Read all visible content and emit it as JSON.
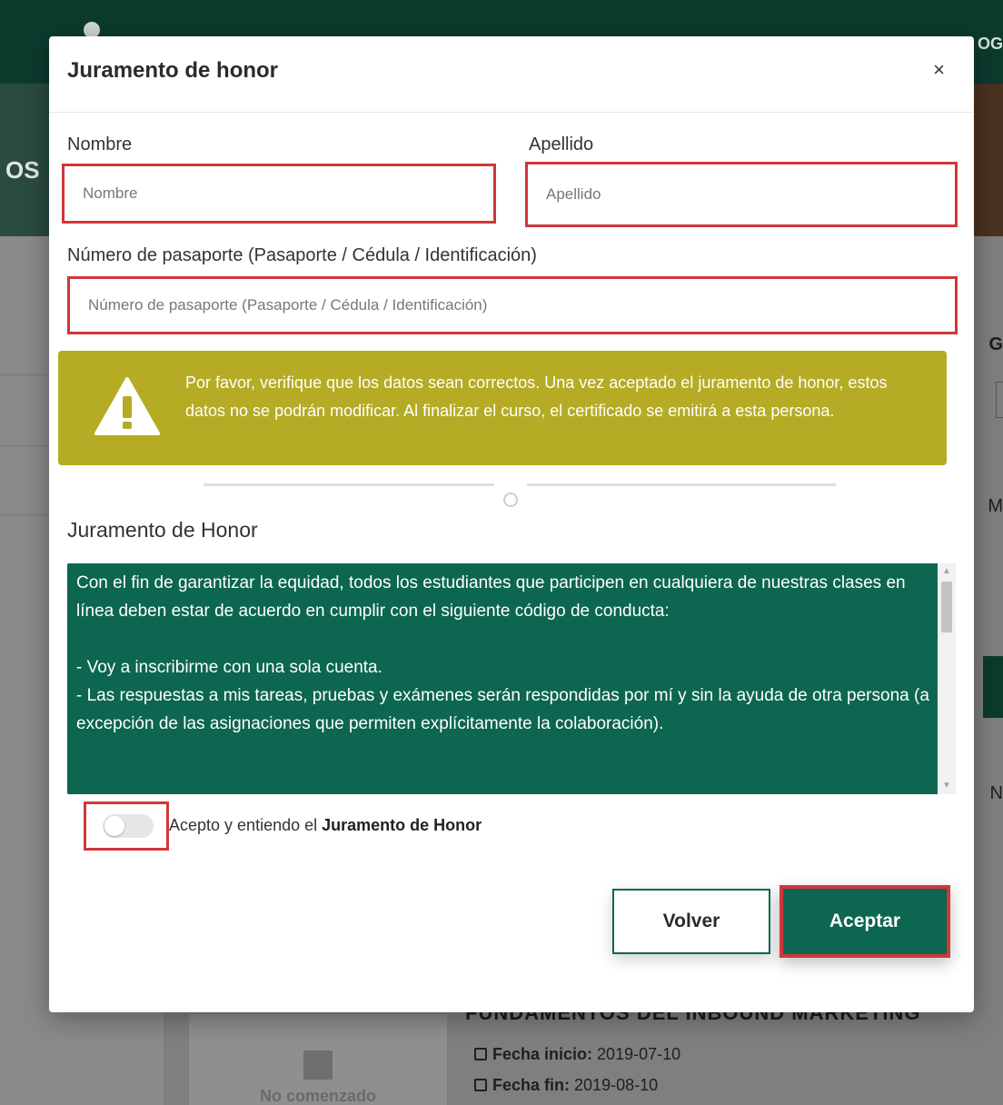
{
  "background": {
    "topbar_right_text": "OG",
    "hero_text": "OS",
    "side_texts": [
      "G",
      "M",
      "N"
    ],
    "card_status": "No comenzado",
    "course_title": "FUNDAMENTOS DEL INBOUND MARKETING",
    "fecha_inicio_label": "Fecha inicio:",
    "fecha_inicio_value": "2019-07-10",
    "fecha_fin_label": "Fecha fin:",
    "fecha_fin_value": "2019-08-10"
  },
  "modal": {
    "title": "Juramento de honor",
    "close_symbol": "×"
  },
  "form": {
    "nombre_label": "Nombre",
    "nombre_placeholder": "Nombre",
    "nombre_value": "",
    "apellido_label": "Apellido",
    "apellido_placeholder": "Apellido",
    "apellido_value": "",
    "pasaporte_label": "Número de pasaporte (Pasaporte / Cédula / Identificación)",
    "pasaporte_placeholder": "Número de pasaporte (Pasaporte / Cédula / Identificación)",
    "pasaporte_value": ""
  },
  "warning": {
    "icon": "warning-triangle-icon",
    "text": "Por favor, verifique que los datos sean correctos. Una vez aceptado el juramento de honor, estos datos no se podrán modificar. Al finalizar el curso, el certificado se emitirá a esta persona."
  },
  "honor": {
    "title": "Juramento de Honor",
    "paragraphs": [
      "Con el fin de garantizar la equidad, todos los estudiantes que participen en cualquiera de nuestras clases en línea deben estar de acuerdo en cumplir con el siguiente código de conducta:",
      "",
      "- Voy a inscribirme con una sola cuenta.",
      "- Las respuestas a mis tareas, pruebas y exámenes serán respondidas por mí y sin la ayuda de otra persona (a excepción de las asignaciones que permiten explícitamente la colaboración)."
    ]
  },
  "accept": {
    "toggle_on": false,
    "label_prefix": "Acepto y entiendo el ",
    "label_bold": "Juramento de Honor"
  },
  "buttons": {
    "volver": "Volver",
    "aceptar": "Aceptar"
  },
  "colors": {
    "primary_green": "#0c6650",
    "dark_green": "#0c3b2e",
    "warning_yellow": "#b5ab25",
    "highlight_red": "#d0373a"
  }
}
